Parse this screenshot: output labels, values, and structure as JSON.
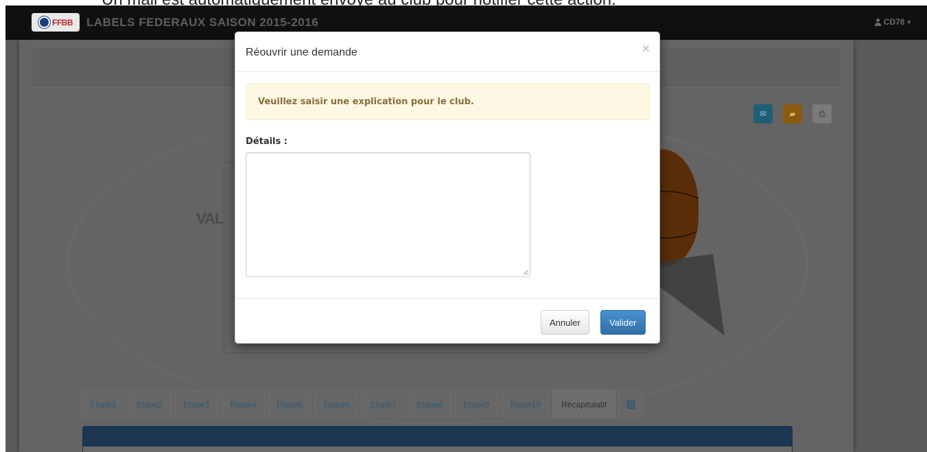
{
  "caption": {
    "text": "Un mail est automatiquement envoyé au club pour notifier cette action."
  },
  "navbar": {
    "logo_text": "FFBB",
    "title": "LABELS FEDERAUX SAISON 2015-2016",
    "user": "CD78",
    "user_icon": "user-icon",
    "caret": "▾"
  },
  "page": {
    "background_text": "VAL",
    "toolbar": {
      "mail_icon": "✉",
      "folder_icon": "▰",
      "print_icon": "⎙"
    },
    "tabs": [
      "Etape1",
      "Etape2",
      "Etape3",
      "Etape4",
      "Etape5",
      "Etape6",
      "Etape7",
      "Etape8",
      "Etape9",
      "Etape10",
      "Récapitulatif"
    ],
    "active_tab": "Récapitulatif"
  },
  "modal": {
    "title": "Réouvrir une demande",
    "close_label": "×",
    "alert": "Veuillez saisir une explication pour le club.",
    "details_label": "Détails :",
    "details_value": "",
    "cancel_label": "Annuler",
    "submit_label": "Valider"
  },
  "colors": {
    "primary": "#3278b3",
    "warning_bg": "#fcf8e3",
    "warning_text": "#8a6d3b",
    "navbar": "#101010"
  }
}
